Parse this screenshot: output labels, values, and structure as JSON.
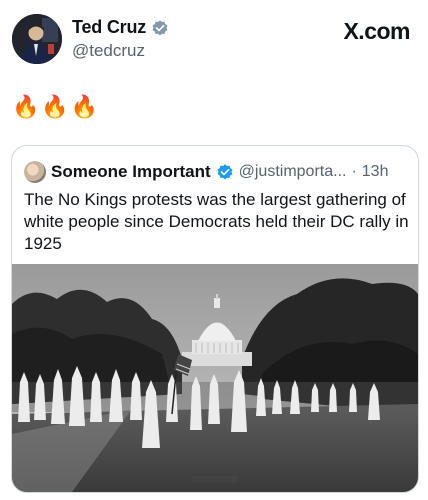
{
  "author": {
    "name": "Ted Cruz",
    "handle": "@tedcruz",
    "verified_color": "#829aab"
  },
  "site_label": "X.com",
  "tweet": {
    "text": "🔥🔥🔥"
  },
  "quoted": {
    "name": "Someone Important",
    "handle": "@justimporta...",
    "separator": "·",
    "time": "13h",
    "text": "The No Kings protests was the largest gathering of white people since Democrats held their DC rally in 1925",
    "verified_color": "#1d9bf0"
  },
  "icons": {
    "verified": "verified-badge-icon"
  }
}
